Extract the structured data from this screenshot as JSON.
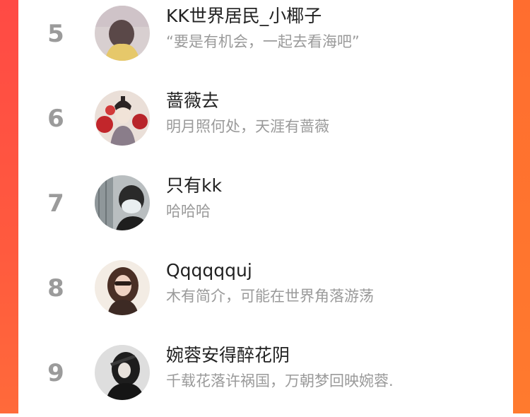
{
  "ranking": [
    {
      "rank": "5",
      "name": "KK世界居民_小椰子",
      "bio": "“要是有机会，一起去看海吧”"
    },
    {
      "rank": "6",
      "name": "蔷薇去",
      "bio": "明月照何处，天涯有蔷薇"
    },
    {
      "rank": "7",
      "name": "只有kk",
      "bio": "哈哈哈"
    },
    {
      "rank": "8",
      "name": "Qqqqqquj",
      "bio": "木有简介，可能在世界角落游荡"
    },
    {
      "rank": "9",
      "name": "婉蓉安得醉花阴",
      "bio": "千载花落许祸国，万朝梦回映婉蓉."
    }
  ],
  "colors": {
    "rank_gray": "#9b9b9b",
    "accent_left": "#ff4a45",
    "accent_right": "#ff7a2e"
  }
}
